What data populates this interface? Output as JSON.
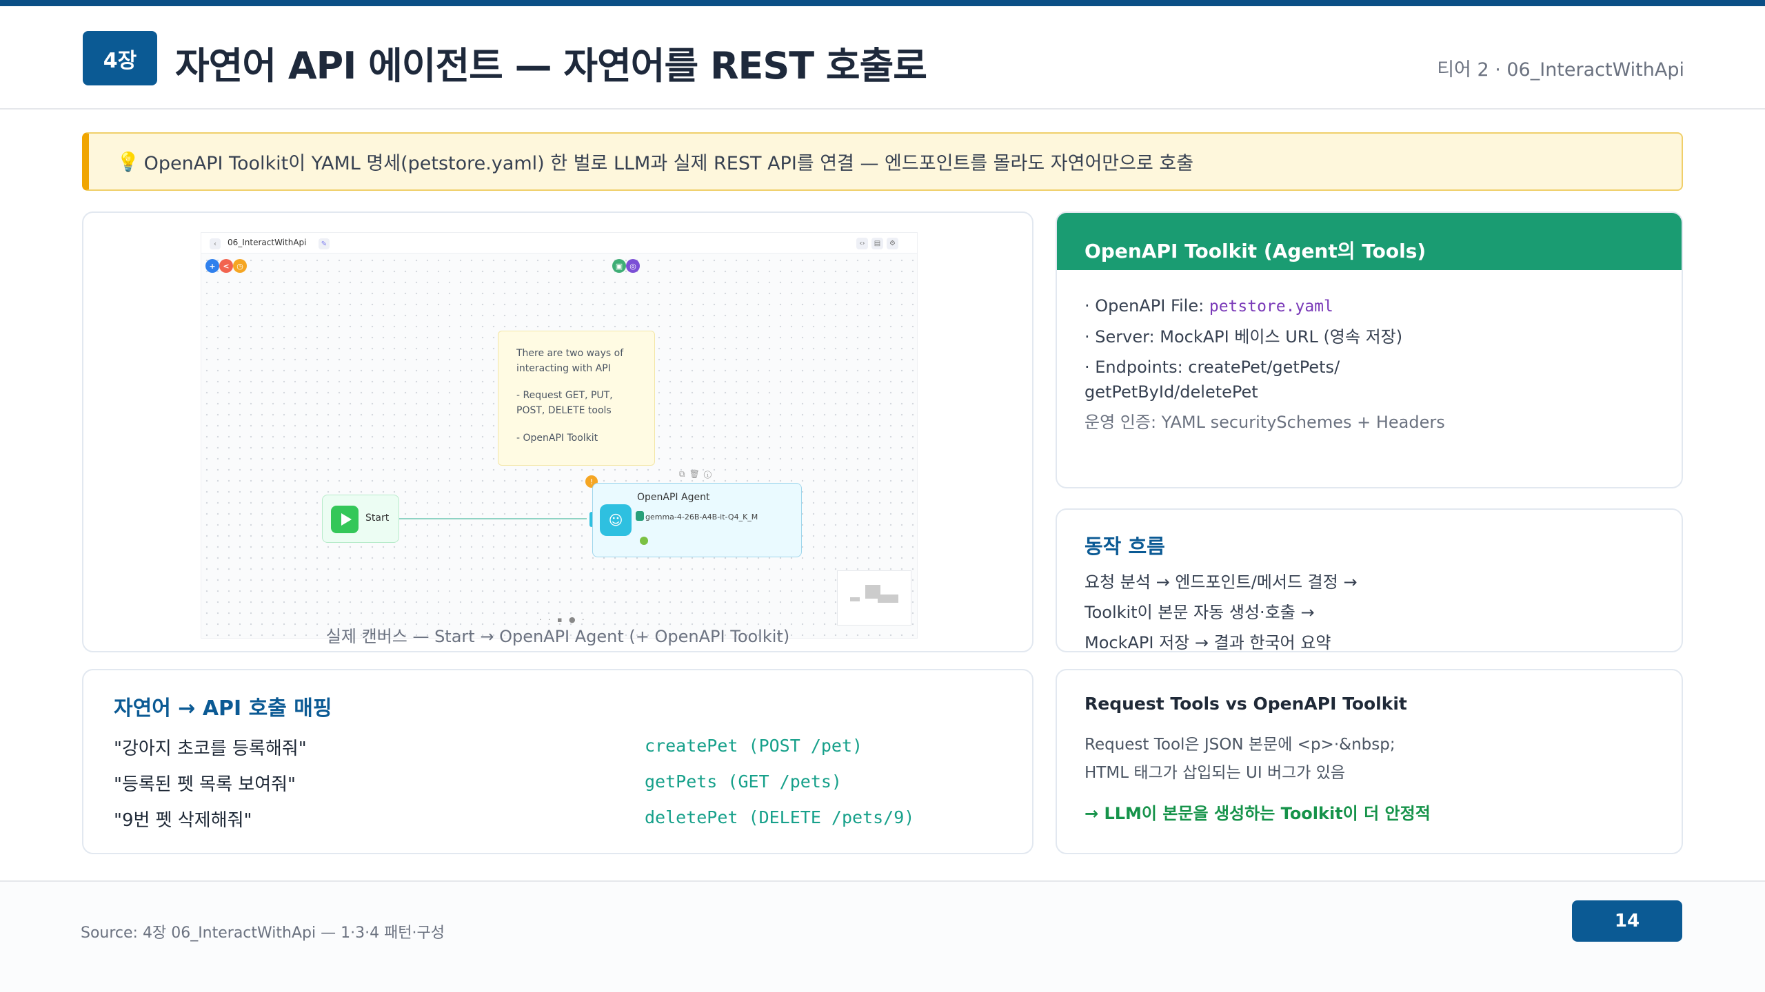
{
  "header": {
    "chapter": "4장",
    "title": "자연어 API 에이전트 — 자연어를 REST 호출로",
    "tier": "티어 2 · 06_InteractWithApi"
  },
  "tip": {
    "icon": "lightbulb-icon",
    "text": "OpenAPI Toolkit이 YAML 명세(petstore.yaml) 한 벌로 LLM과 실제 REST API를 연결 — 엔드포인트를 몰라도 자연어만으로 호출"
  },
  "canvas": {
    "flow_name": "06_InteractWithApi",
    "sticky_lines": [
      "There are two ways of interacting with API",
      "- Request GET, PUT, POST, DELETE tools",
      "- OpenAPI Toolkit"
    ],
    "start_label": "Start",
    "agent_title": "OpenAPI Agent",
    "agent_model": "gemma-4-26B-A4B-it-Q4_K_M",
    "caption": "실제 캔버스 — Start → OpenAPI Agent (+ OpenAPI Toolkit)"
  },
  "toolkit": {
    "title": "OpenAPI Toolkit (Agent의 Tools)",
    "file_label": "· OpenAPI File: ",
    "file_value": "petstore.yaml",
    "server": "· Server: MockAPI 베이스 URL (영속 저장)",
    "endpoints_1": "· Endpoints: createPet/getPets/",
    "endpoints_2": "getPetById/deletePet",
    "auth": "운영 인증: YAML securitySchemes + Headers"
  },
  "flow": {
    "title": "동작 흐름",
    "line1": "요청 분석 → 엔드포인트/메서드 결정 →",
    "line2": "Toolkit이 본문 자동 생성·호출 →",
    "line3": "MockAPI 저장 → 결과 한국어 요약"
  },
  "mapping": {
    "title": "자연어 → API 호출 매핑",
    "rows": [
      {
        "query": "\"강아지 초코를 등록해줘\"",
        "call": "createPet (POST /pet)"
      },
      {
        "query": "\"등록된 펫 목록 보여줘\"",
        "call": "getPets (GET /pets)"
      },
      {
        "query": "\"9번 펫 삭제해줘\"",
        "call": "deletePet (DELETE /pets/9)"
      }
    ]
  },
  "request": {
    "title": "Request Tools vs OpenAPI Toolkit",
    "line1": "Request Tool은 JSON 본문에 <p>·&nbsp;",
    "line2": "HTML 태그가 삽입되는 UI 버그가 있음",
    "conclusion": "→ LLM이 본문을 생성하는 Toolkit이 더 안정적"
  },
  "footer": {
    "source": "Source: 4장 06_InteractWithApi — 1·3·4 패턴·구성",
    "page": "14"
  },
  "colors": {
    "brand": "#0b5a94",
    "toolkit_header": "#1a9c72",
    "tip_border": "#f0a500",
    "code": "#16a08a",
    "conclusion": "#16934a"
  }
}
